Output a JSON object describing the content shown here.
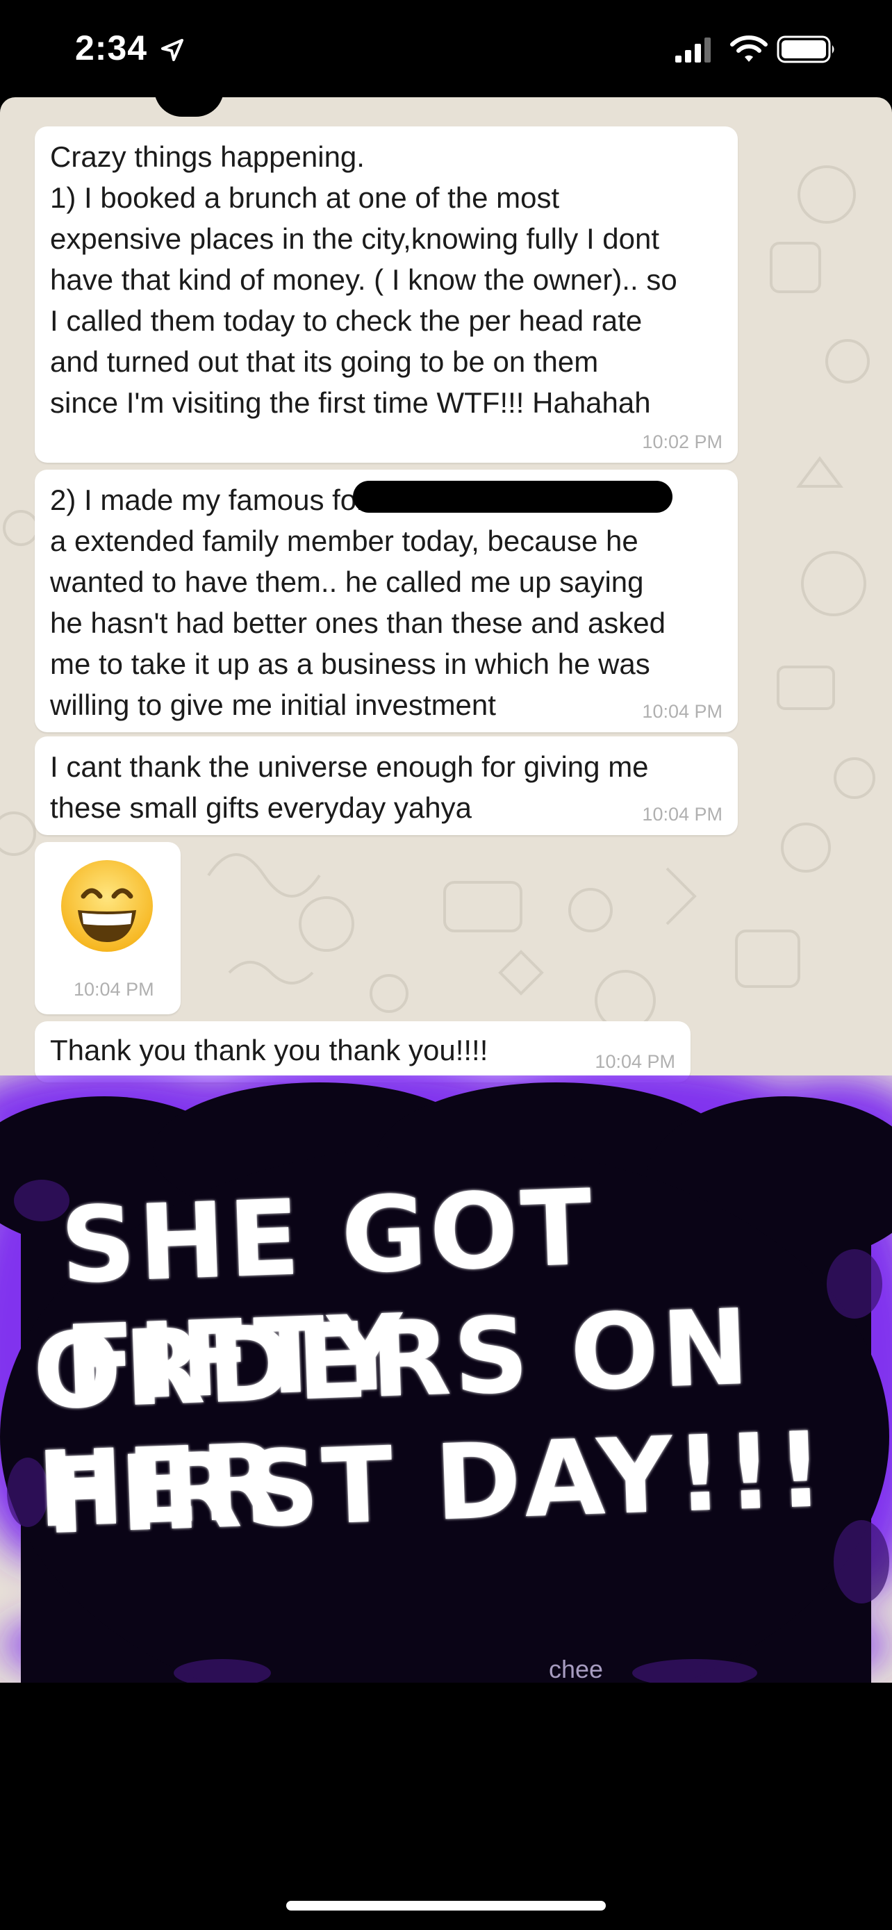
{
  "status_bar": {
    "time": "2:34",
    "icons": [
      "location-arrow-icon",
      "cellular-signal-icon",
      "wifi-icon",
      "battery-icon"
    ]
  },
  "chat": {
    "background_color": "#e7e1d6",
    "bubble_color": "#ffffff",
    "messages": [
      {
        "text": "Crazy things happening.\n1) I booked a brunch at one of the most\nexpensive places in the city,knowing fully I dont\nhave that kind of money. ( I know the owner).. so\nI called them today to check the per head rate\nand turned out that its going to be on them\nsince I'm visiting the first time WTF!!! Hahahah",
        "time": "10:02 PM"
      },
      {
        "text": "2) I made my famous                                        for\na extended family member today, because he\nwanted to have them.. he called me up saying\nhe hasn't had better ones than these and asked\nme to take it up as a business in which he was\nwilling to give me initial investment",
        "time": "10:04 PM"
      },
      {
        "text": "I cant thank the universe enough for giving me\nthese small gifts everyday yahya",
        "time": "10:04 PM"
      },
      {
        "emoji": "grinning-face-icon",
        "time": "10:04 PM"
      },
      {
        "text": "Thank you thank you thank you!!!!",
        "time": "10:04 PM"
      }
    ]
  },
  "overlay": {
    "line1": "SHE GOT FIFTY",
    "line2": "ORDERS ON HER",
    "line3": "FIRST DAY!!!",
    "glow_color": "#7b2cf0",
    "peek_text": "chee"
  }
}
